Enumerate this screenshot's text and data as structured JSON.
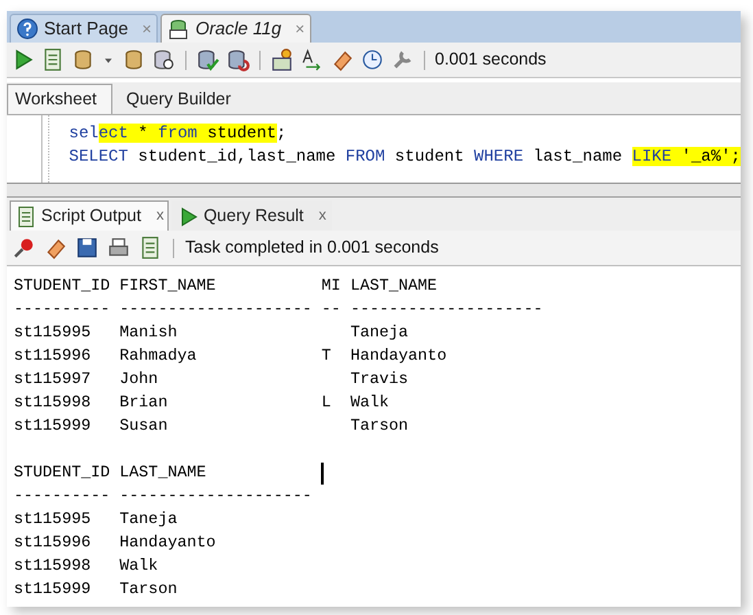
{
  "doc_tabs": [
    {
      "label": "Start Page",
      "selected": false,
      "close": "×"
    },
    {
      "label": "Oracle 11g",
      "selected": true,
      "close": "×"
    }
  ],
  "toolbar": {
    "timing": "0.001 seconds"
  },
  "editor_tabs": [
    {
      "label": "Worksheet",
      "selected": true
    },
    {
      "label": "Query Builder",
      "selected": false
    }
  ],
  "editor_lines": [
    [
      {
        "text": "sel",
        "kind": "keyword",
        "highlighted": false
      },
      {
        "text": "ect",
        "kind": "keyword",
        "highlighted": true
      },
      {
        "text": " * ",
        "kind": "plain",
        "highlighted": true
      },
      {
        "text": "from",
        "kind": "keyword",
        "highlighted": true
      },
      {
        "text": " student",
        "kind": "plain",
        "highlighted": true
      },
      {
        "text": ";",
        "kind": "plain",
        "highlighted": false
      }
    ],
    [
      {
        "text": "SELECT",
        "kind": "keyword",
        "highlighted": false
      },
      {
        "text": " student_id,last_name ",
        "kind": "plain",
        "highlighted": false
      },
      {
        "text": "FROM",
        "kind": "keyword",
        "highlighted": false
      },
      {
        "text": " student ",
        "kind": "plain",
        "highlighted": false
      },
      {
        "text": "WHERE",
        "kind": "keyword",
        "highlighted": false
      },
      {
        "text": " last_name ",
        "kind": "plain",
        "highlighted": false
      },
      {
        "text": "LIKE",
        "kind": "keyword",
        "highlighted": true
      },
      {
        "text": " '_a%';",
        "kind": "plain",
        "highlighted": true
      }
    ]
  ],
  "output_tabs": [
    {
      "label": "Script Output",
      "selected": true,
      "close": "x"
    },
    {
      "label": "Query Result",
      "selected": false,
      "close": "x"
    }
  ],
  "output_toolbar": {
    "status": "Task completed in 0.001 seconds"
  },
  "result_sets": [
    {
      "columns": [
        {
          "header": "STUDENT_ID",
          "rule": "----------"
        },
        {
          "header": "FIRST_NAME",
          "rule": "--------------------"
        },
        {
          "header": "MI",
          "rule": "--"
        },
        {
          "header": "LAST_NAME",
          "rule": "--------------------"
        }
      ],
      "rows": [
        [
          "st115995",
          "Manish",
          "",
          "Taneja"
        ],
        [
          "st115996",
          "Rahmadya",
          "T",
          "Handayanto"
        ],
        [
          "st115997",
          "John",
          "",
          "Travis"
        ],
        [
          "st115998",
          "Brian",
          "L",
          "Walk"
        ],
        [
          "st115999",
          "Susan",
          "",
          "Tarson"
        ]
      ]
    },
    {
      "columns": [
        {
          "header": "STUDENT_ID",
          "rule": "----------"
        },
        {
          "header": "LAST_NAME",
          "rule": "--------------------"
        }
      ],
      "rows": [
        [
          "st115995",
          "Taneja"
        ],
        [
          "st115996",
          "Handayanto"
        ],
        [
          "st115998",
          "Walk"
        ],
        [
          "st115999",
          "Tarson"
        ]
      ]
    }
  ]
}
